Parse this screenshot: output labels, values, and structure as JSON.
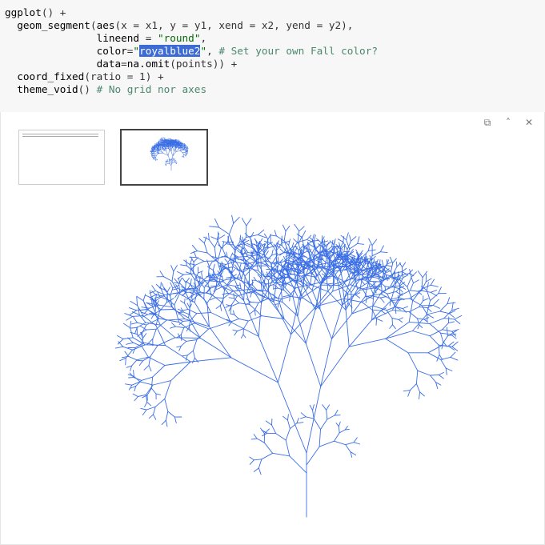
{
  "editor": {
    "lines": [
      [
        {
          "t": "ggplot",
          "c": "tok-n"
        },
        {
          "t": "() +",
          "c": "tok-p"
        }
      ],
      [
        {
          "t": "  geom_segment",
          "c": "tok-n"
        },
        {
          "t": "(",
          "c": "tok-p"
        },
        {
          "t": "aes",
          "c": "tok-n"
        },
        {
          "t": "(x = x1, y = y1, xend = x2, yend = y2),",
          "c": "tok-p"
        }
      ],
      [
        {
          "t": "               lineend",
          "c": "tok-n"
        },
        {
          "t": " = ",
          "c": "tok-p"
        },
        {
          "t": "\"round\"",
          "c": "tok-s"
        },
        {
          "t": ",",
          "c": "tok-p"
        }
      ],
      [
        {
          "t": "               color",
          "c": "tok-n"
        },
        {
          "t": "=",
          "c": "tok-p"
        },
        {
          "t": "\"",
          "c": "tok-s"
        },
        {
          "t": "royalblue2",
          "c": "sel"
        },
        {
          "t": "\"",
          "c": "tok-s"
        },
        {
          "t": ", ",
          "c": "tok-p"
        },
        {
          "t": "# Set your own Fall color?",
          "c": "tok-c"
        }
      ],
      [
        {
          "t": "               data",
          "c": "tok-n"
        },
        {
          "t": "=",
          "c": "tok-p"
        },
        {
          "t": "na.omit",
          "c": "tok-n"
        },
        {
          "t": "(points)) +",
          "c": "tok-p"
        }
      ],
      [
        {
          "t": "  coord_fixed",
          "c": "tok-n"
        },
        {
          "t": "(ratio = 1) +",
          "c": "tok-p"
        }
      ],
      [
        {
          "t": "  theme_void",
          "c": "tok-n"
        },
        {
          "t": "() ",
          "c": "tok-p"
        },
        {
          "t": "# No grid nor axes",
          "c": "tok-c"
        }
      ]
    ]
  },
  "output": {
    "toolbar": [
      {
        "name": "popout-icon",
        "glyph": "⧉"
      },
      {
        "name": "collapse-icon",
        "glyph": "˄"
      },
      {
        "name": "close-icon",
        "glyph": "✕"
      }
    ]
  },
  "plot": {
    "type": "fractal-tree",
    "line_color": "#3a6ee6"
  }
}
